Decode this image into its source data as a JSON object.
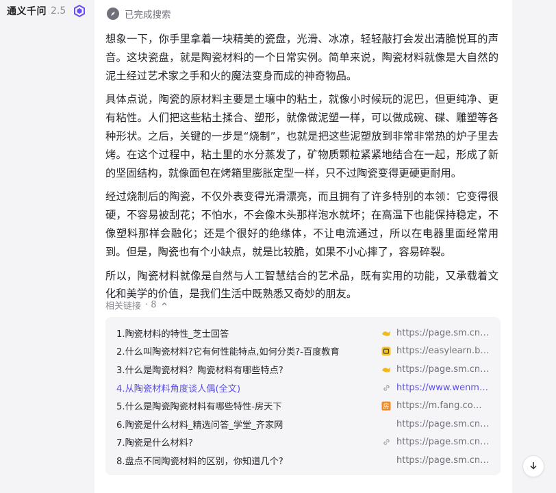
{
  "header": {
    "brand": "通义千问",
    "version": "2.5",
    "logo_icon": "tongyi-logo-icon",
    "accent": "#6b4cf5"
  },
  "search_status": {
    "label": "已完成搜索",
    "icon": "search-compass-icon"
  },
  "answer": {
    "paragraphs": [
      "想象一下，你手里拿着一块精美的瓷盘，光滑、冰凉，轻轻敲打会发出清脆悦耳的声音。这块瓷盘，就是陶瓷材料的一个日常实例。简单来说，陶瓷材料就像是大自然的泥土经过艺术家之手和火的魔法变身而成的神奇物品。",
      "具体点说，陶瓷的原材料主要是土壤中的粘土，就像小时候玩的泥巴，但更纯净、更有粘性。人们把这些粘土揉合、塑形，就像做泥塑一样，可以做成碗、碟、雕塑等各种形状。之后，关键的一步是“烧制”，也就是把这些泥塑放到非常非常热的炉子里去烤。在这个过程中，粘土里的水分蒸发了，矿物质颗粒紧紧地结合在一起，形成了新的坚固结构，就像面包在烤箱里膨胀定型一样，只不过陶瓷变得更硬更耐用。",
      "经过烧制后的陶瓷，不仅外表变得光滑漂亮，而且拥有了许多特别的本领：它变得很硬，不容易被刮花；不怕水，不会像木头那样泡水就坏；在高温下也能保持稳定，不像塑料那样会融化；还是个很好的绝缘体，不让电流通过，所以在电器里面经常用到。但是，陶瓷也有个小缺点，就是比较脆，如果不小心摔了，容易碎裂。",
      "所以，陶瓷材料就像是自然与人工智慧结合的艺术品，既有实用的功能，又承载着文化和美学的价值，是我们生活中既熟悉又奇妙的朋友。"
    ]
  },
  "links": {
    "label": "相关链接",
    "count": "· 8",
    "items": [
      {
        "title": "1.陶瓷材料的特性_芝士回答",
        "url": "https://page.sm.cn/...",
        "source_icon": "sm-search-icon"
      },
      {
        "title": "2.什么叫陶瓷材料?它有何性能特点,如何分类?-百度教育",
        "url": "https://easylearn.ba...",
        "source_icon": "baidu-education-icon"
      },
      {
        "title": "3.什么是陶瓷材料？陶瓷材料有哪些特点?",
        "url": "https://page.sm.cn/...",
        "source_icon": "sm-search-icon"
      },
      {
        "title": "4.从陶瓷材料角度谈人偶(全文)",
        "url": "https://www.wenmi....",
        "source_icon": "link-icon",
        "active": true
      },
      {
        "title": "5.什么是陶瓷陶瓷材料有哪些特性-房天下",
        "url": "https://m.fang.com/...",
        "source_icon": "fang-icon",
        "source_glyph": "房"
      },
      {
        "title": "6.陶瓷是什么材料_精选问答_学堂_齐家网",
        "url": "https://page.sm.cn/...",
        "source_icon": "none"
      },
      {
        "title": "7.陶瓷是什么材料?",
        "url": "https://page.sm.cn/...",
        "source_icon": "link-icon"
      },
      {
        "title": "8.盘点不同陶瓷材料的区别，你知道几个?",
        "url": "https://page.sm.cn/...",
        "source_icon": "none"
      }
    ]
  },
  "colors": {
    "accent": "#5a4fe6",
    "panel_bg": "#f5f5f7",
    "text": "#26262d",
    "muted": "#8b8b96"
  }
}
